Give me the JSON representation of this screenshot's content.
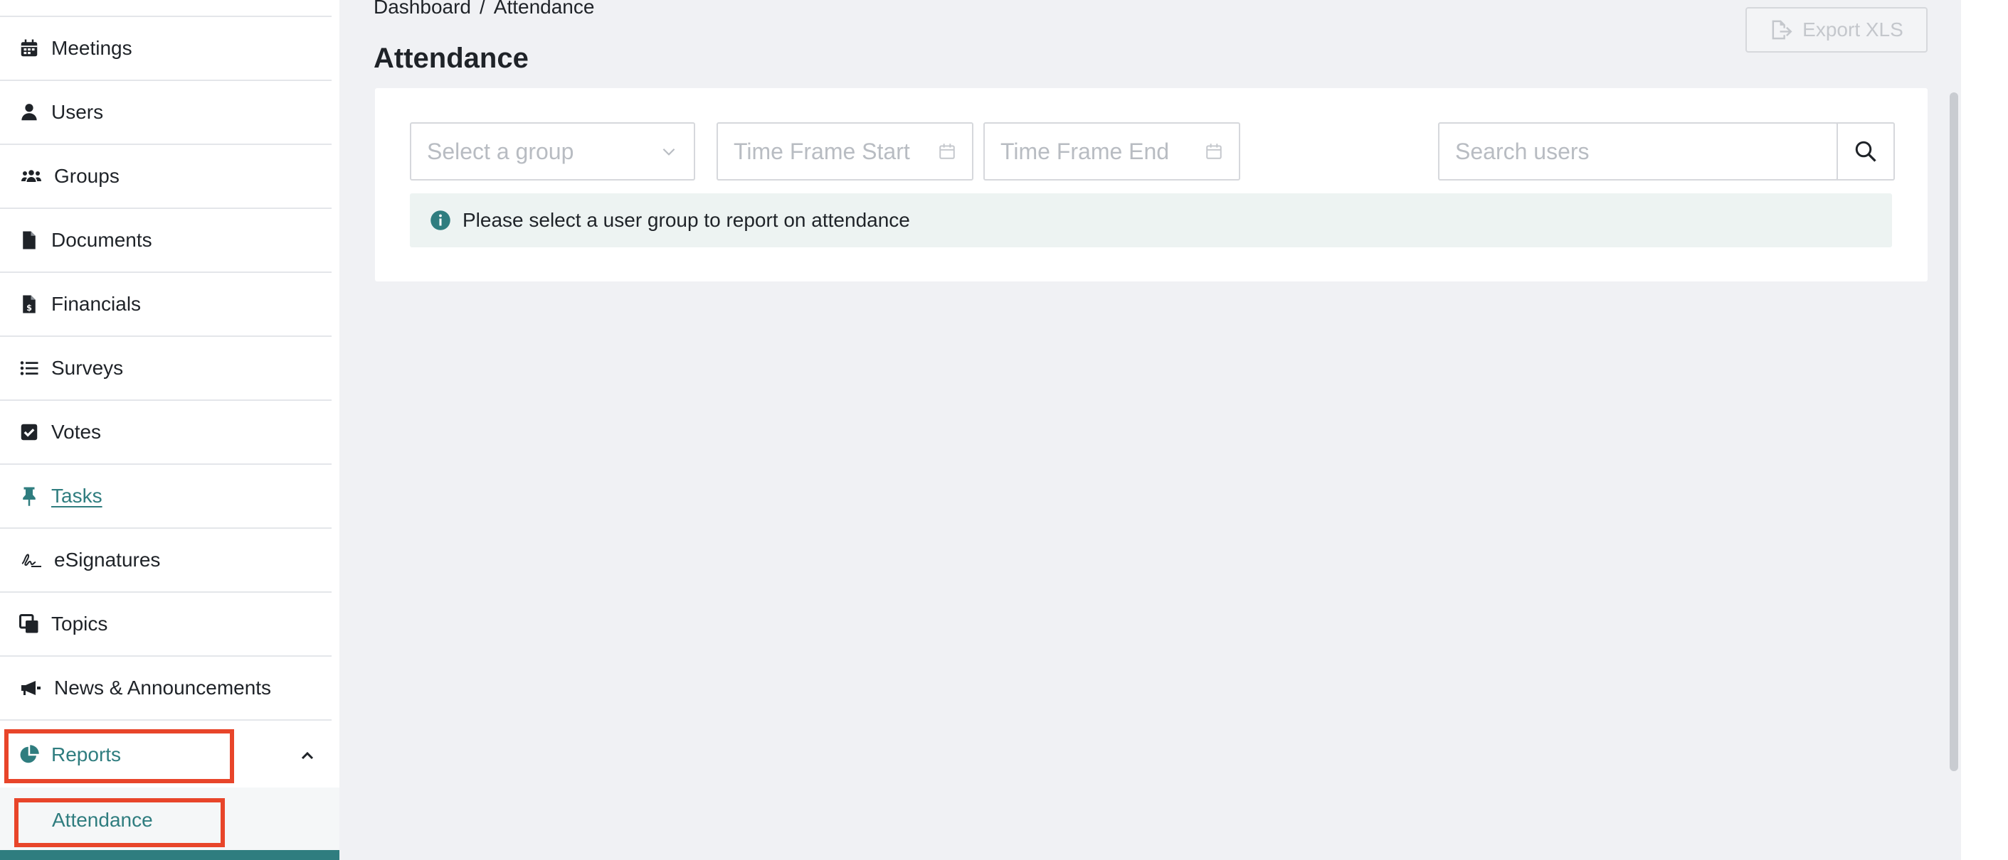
{
  "sidebar": {
    "items": [
      {
        "label": "Meetings",
        "icon": "calendar-icon"
      },
      {
        "label": "Users",
        "icon": "user-icon"
      },
      {
        "label": "Groups",
        "icon": "users-group-icon"
      },
      {
        "label": "Documents",
        "icon": "document-icon"
      },
      {
        "label": "Financials",
        "icon": "financial-document-icon"
      },
      {
        "label": "Surveys",
        "icon": "list-icon"
      },
      {
        "label": "Votes",
        "icon": "checkbox-icon"
      },
      {
        "label": "Tasks",
        "icon": "pin-icon"
      },
      {
        "label": "eSignatures",
        "icon": "signature-icon"
      },
      {
        "label": "Topics",
        "icon": "clone-icon"
      },
      {
        "label": "News & Announcements",
        "icon": "megaphone-icon"
      },
      {
        "label": "Reports",
        "icon": "pie-chart-icon"
      }
    ],
    "submenu": {
      "attendance": "Attendance"
    }
  },
  "header": {
    "breadcrumb": {
      "home": "Dashboard",
      "separator": "/",
      "current": "Attendance"
    },
    "title": "Attendance",
    "export_label": "Export XLS"
  },
  "filters": {
    "group_placeholder": "Select a group",
    "start_placeholder": "Time Frame Start",
    "end_placeholder": "Time Frame End",
    "search_placeholder": "Search users"
  },
  "info": {
    "message": "Please select a user group to report on attendance"
  },
  "colors": {
    "accent": "#2f7d7f",
    "highlight": "#e8452a",
    "info_bg": "#edf3f2",
    "page_bg": "#f0f1f4"
  }
}
